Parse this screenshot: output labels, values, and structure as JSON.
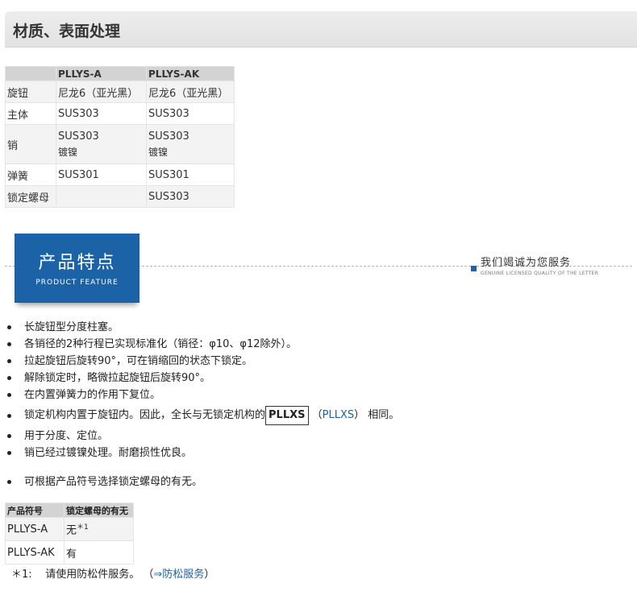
{
  "header": {
    "title": "材质、表面处理"
  },
  "materials": {
    "columns": [
      "",
      "PLLYS-A",
      "PLLYS-AK"
    ],
    "rows": [
      {
        "part": "旋钮",
        "a": "尼龙6（亚光黑）",
        "a2": "",
        "ak": "尼龙6（亚光黑）",
        "ak2": ""
      },
      {
        "part": "主体",
        "a": "SUS303",
        "a2": "",
        "ak": "SUS303",
        "ak2": ""
      },
      {
        "part": "销",
        "a": "SUS303",
        "a2": "镀镍",
        "ak": "SUS303",
        "ak2": "镀镍"
      },
      {
        "part": "弹簧",
        "a": "SUS301",
        "a2": "",
        "ak": "SUS301",
        "ak2": ""
      },
      {
        "part": "锁定螺母",
        "a": "",
        "a2": "",
        "ak": "SUS303",
        "ak2": ""
      }
    ]
  },
  "feature_banner": {
    "title": "产品特点",
    "subtitle": "PRODUCT FEATURE",
    "slogan": "我们竭诚为您服务",
    "slogan_en": "GENUINE LICENSED QUALITY OF THE LETTER"
  },
  "features": [
    "长旋钮型分度柱塞。",
    "各销径的2种行程已实现标准化（销径：φ10、φ12除外）。",
    "拉起旋钮后旋转90°，可在销缩回的状态下锁定。",
    "解除锁定时，略微拉起旋钮后旋转90°。",
    "在内置弹簧力的作用下复位。",
    {
      "prefix": "锁定机构内置于旋钮内。因此，全长与无锁定机构的",
      "boxed": "PLLXS",
      "link_open": "（",
      "link_text": "PLLXS",
      "link_close": "）",
      "suffix": "相同。"
    },
    "用于分度、定位。",
    "销已经过镀镍处理。耐磨损性优良。",
    "可根据产品符号选择锁定螺母的有无。"
  ],
  "symbol_table": {
    "columns": [
      "产品符号",
      "锁定螺母的有无"
    ],
    "rows": [
      {
        "code": "PLLYS-A",
        "nut": "无",
        "note": "＊1"
      },
      {
        "code": "PLLYS-AK",
        "nut": "有",
        "note": ""
      }
    ]
  },
  "footnote": {
    "mark": "＊1:",
    "text": "请使用防松件服务。",
    "link_open": "（",
    "link_text": "⇒防松服务",
    "link_close": "）"
  }
}
